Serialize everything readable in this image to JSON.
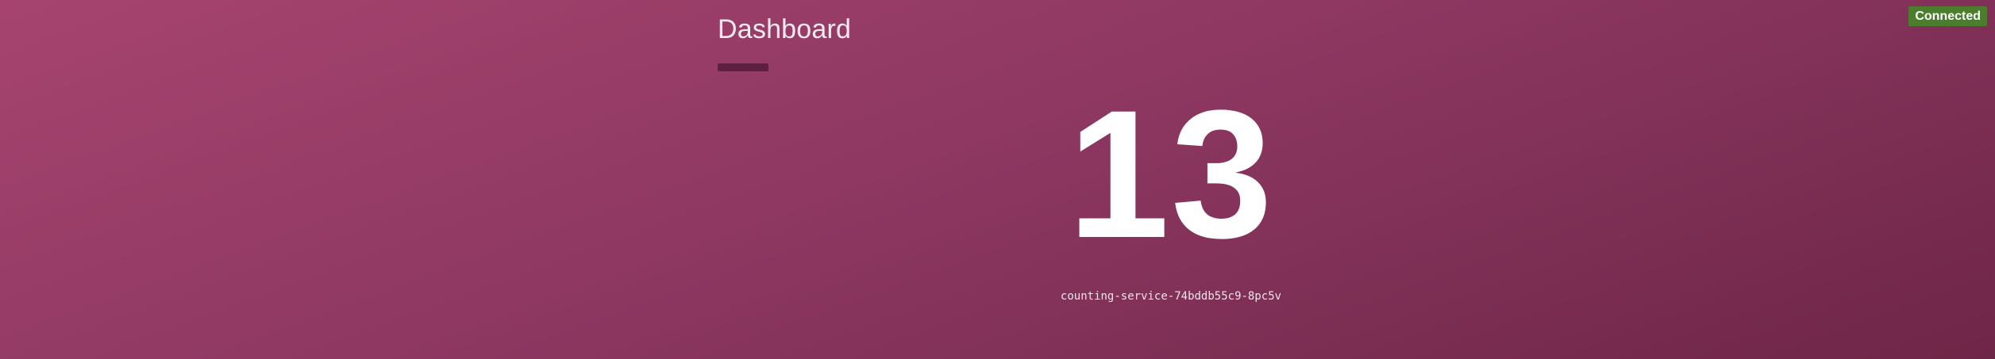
{
  "header": {
    "title": "Dashboard"
  },
  "status": {
    "label": "Connected",
    "color": "#4a7d2c"
  },
  "counter": {
    "value": "13"
  },
  "service": {
    "id": "counting-service-74bddb55c9-8pc5v"
  },
  "theme": {
    "background_start": "#a6446f",
    "background_end": "#6e2647",
    "accent_bar": "#5e2040"
  }
}
